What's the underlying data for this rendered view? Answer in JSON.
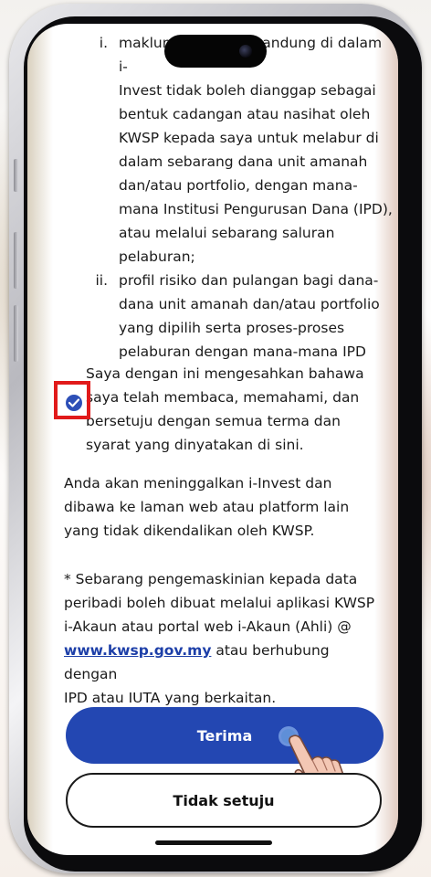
{
  "list_items": [
    {
      "num": "i.",
      "lines": [
        "maklumat yang terkandung di dalam i-",
        "Invest tidak boleh dianggap sebagai",
        "bentuk cadangan atau nasihat oleh",
        "KWSP kepada saya untuk melabur di",
        "dalam sebarang dana unit amanah",
        "dan/atau portfolio, dengan mana-",
        "mana Institusi Pengurusan Dana (IPD),",
        "atau melalui sebarang saluran",
        "pelaburan;"
      ]
    },
    {
      "num": "ii.",
      "lines": [
        "profil risiko dan pulangan bagi dana-",
        "dana unit amanah dan/atau portfolio",
        "yang dipilih serta proses-proses",
        "pelaburan dengan mana-mana IPD"
      ]
    }
  ],
  "consent": {
    "checked": true,
    "lines": [
      "Saya dengan ini mengesahkan bahawa",
      "saya telah membaca, memahami, dan",
      "bersetuju dengan semua terma dan",
      "syarat yang dinyatakan di sini."
    ]
  },
  "leaving_notice": {
    "lines": [
      "Anda akan meninggalkan i-Invest dan",
      "dibawa ke laman web atau platform lain",
      "yang tidak dikendalikan oleh KWSP."
    ]
  },
  "update_notice": {
    "line1": "* Sebarang pengemaskinian kepada data",
    "line2": "peribadi boleh dibuat melalui aplikasi KWSP",
    "line3": "i-Akaun atau portal web i-Akaun (Ahli) @",
    "link": "www.kwsp.gov.my",
    "line4_after_link": " atau berhubung dengan",
    "line5": "IPD atau IUTA yang berkaitan."
  },
  "buttons": {
    "accept": "Terima",
    "decline": "Tidak setuju"
  },
  "colors": {
    "primary": "#2347b2",
    "link": "#1d3fa8",
    "highlight": "#e11a1a"
  },
  "icons": {
    "checkbox": "check-circle-icon",
    "tap": "pointing-hand-icon"
  }
}
